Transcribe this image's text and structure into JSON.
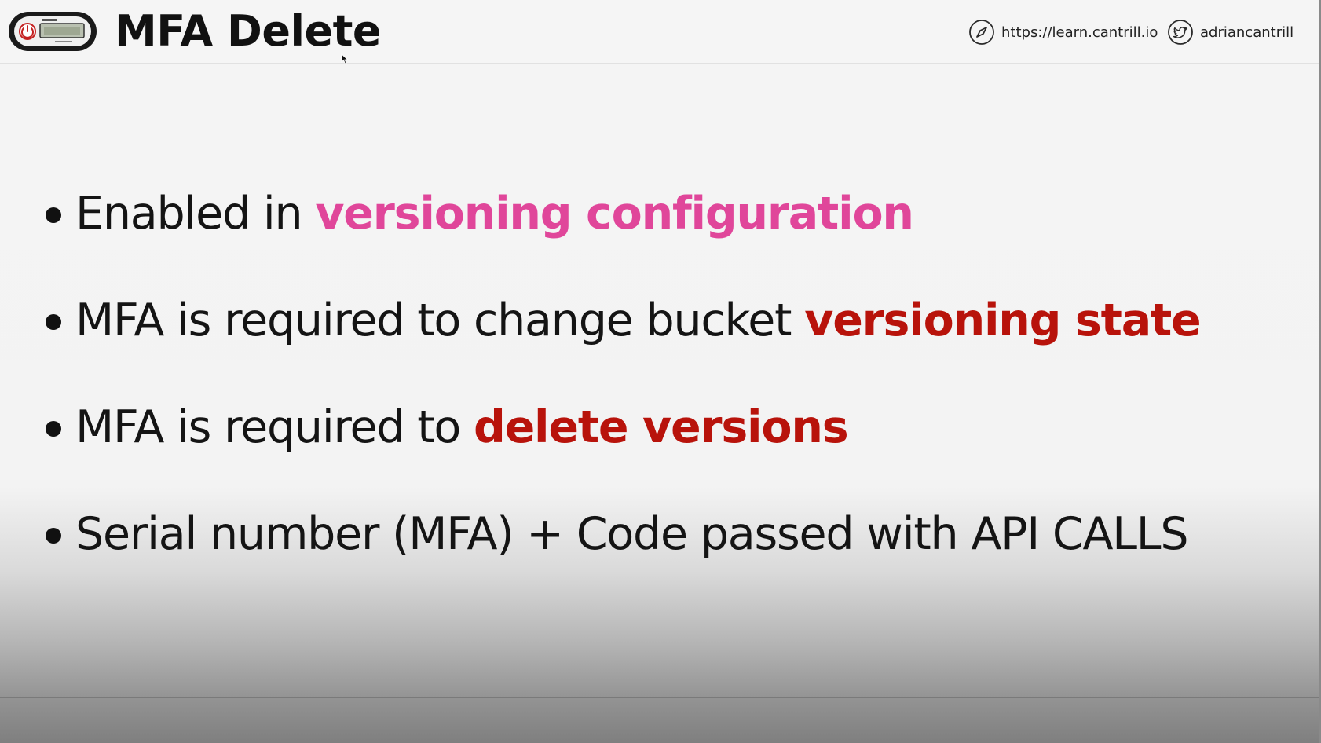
{
  "slide": {
    "title": "MFA Delete",
    "logo_icon": "mfa-token-device-icon",
    "header_links": {
      "website": {
        "text": "https://learn.cantrill.io",
        "icon": "compass-icon"
      },
      "twitter": {
        "text": "adriancantrill",
        "icon": "twitter-bird-icon"
      }
    },
    "bullets": [
      {
        "prefix": "Enabled in ",
        "highlight": "versioning configuration",
        "highlight_color": "#e0469a"
      },
      {
        "prefix": "MFA is required to change bucket ",
        "highlight": "versioning state",
        "highlight_color": "#b8130b"
      },
      {
        "prefix": "MFA is required to ",
        "highlight": "delete versions",
        "highlight_color": "#b8130b"
      },
      {
        "prefix": "Serial number (MFA) + Code passed with API CALLS",
        "highlight": "",
        "highlight_color": ""
      }
    ]
  },
  "colors": {
    "text": "#141414",
    "pink_accent": "#e0469a",
    "red_accent": "#b8130b",
    "background": "#f3f3f3"
  }
}
